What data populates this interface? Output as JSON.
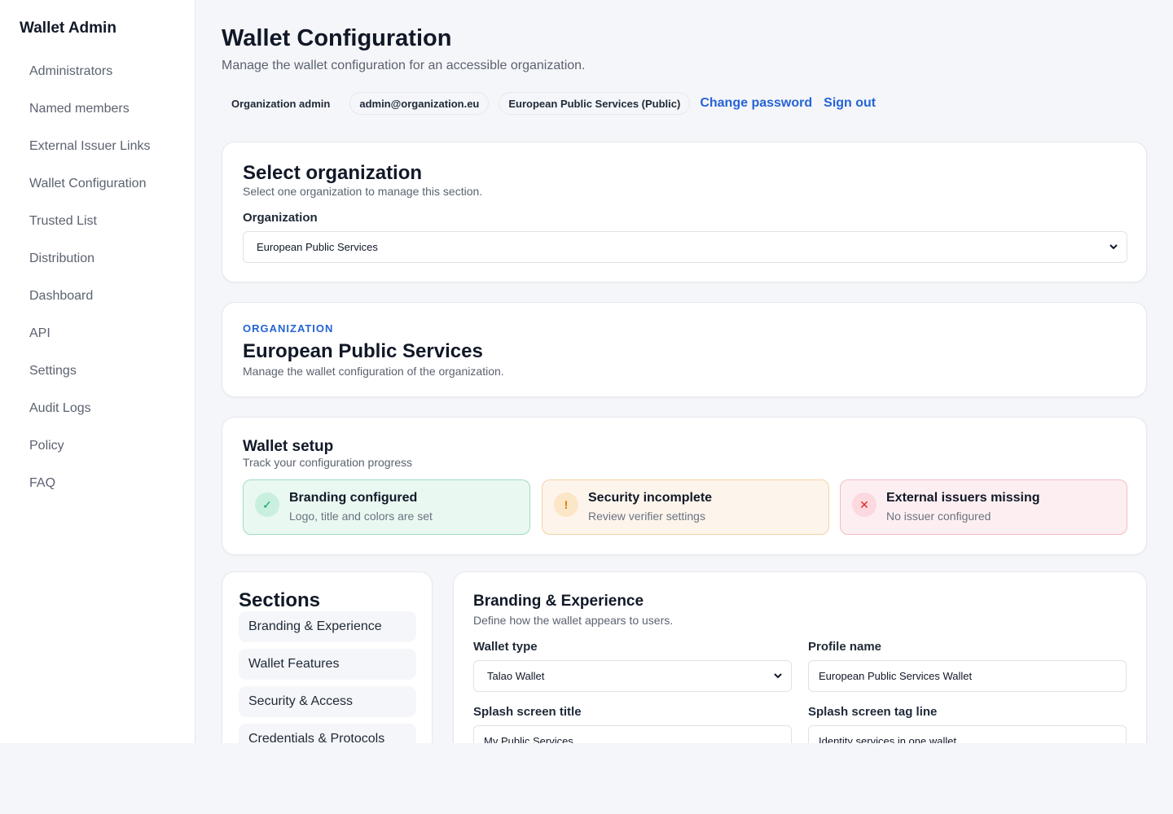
{
  "sidebar": {
    "brand": "Wallet Admin",
    "items": [
      {
        "label": "Administrators"
      },
      {
        "label": "Named members"
      },
      {
        "label": "External Issuer Links"
      },
      {
        "label": "Wallet Configuration"
      },
      {
        "label": "Trusted List"
      },
      {
        "label": "Distribution"
      },
      {
        "label": "Dashboard"
      },
      {
        "label": "API"
      },
      {
        "label": "Settings"
      },
      {
        "label": "Audit Logs"
      },
      {
        "label": "Policy"
      },
      {
        "label": "FAQ"
      }
    ]
  },
  "header": {
    "title": "Wallet Configuration",
    "subtitle": "Manage the wallet configuration for an accessible organization.",
    "role_chip": "Organization admin",
    "email_chip": "admin@organization.eu",
    "org_chip": "European Public Services (Public)",
    "change_password": "Change password",
    "sign_out": "Sign out"
  },
  "select_org": {
    "title": "Select organization",
    "subtitle": "Select one organization to manage this section.",
    "field_label": "Organization",
    "selected": "European Public Services"
  },
  "org_card": {
    "kicker": "ORGANIZATION",
    "title": "European Public Services",
    "subtitle": "Manage the wallet configuration of the organization."
  },
  "setup": {
    "title": "Wallet setup",
    "subtitle": "Track your configuration progress",
    "items": [
      {
        "title": "Branding configured",
        "sub": "Logo, title and colors are set",
        "symbol": "✓",
        "state": "success"
      },
      {
        "title": "Security incomplete",
        "sub": "Review verifier settings",
        "symbol": "!",
        "state": "warning"
      },
      {
        "title": "External issuers missing",
        "sub": "No issuer configured",
        "symbol": "✕",
        "state": "error"
      }
    ]
  },
  "sections": {
    "title": "Sections",
    "items": [
      {
        "label": "Branding & Experience"
      },
      {
        "label": "Wallet Features"
      },
      {
        "label": "Security & Access"
      },
      {
        "label": "Credentials & Protocols"
      }
    ]
  },
  "branding": {
    "title": "Branding & Experience",
    "subtitle": "Define how the wallet appears to users.",
    "wallet_type_label": "Wallet type",
    "wallet_type_value": "Talao Wallet",
    "profile_name_label": "Profile name",
    "profile_name_value": "European Public Services Wallet",
    "splash_title_label": "Splash screen title",
    "splash_title_value": "My Public Services",
    "splash_tagline_label": "Splash screen tag line",
    "splash_tagline_value": "Identity services in one wallet"
  },
  "colors": {
    "accent": "#2563d6",
    "success": "#10b981",
    "warning": "#f59e0b",
    "error": "#dc2626"
  }
}
